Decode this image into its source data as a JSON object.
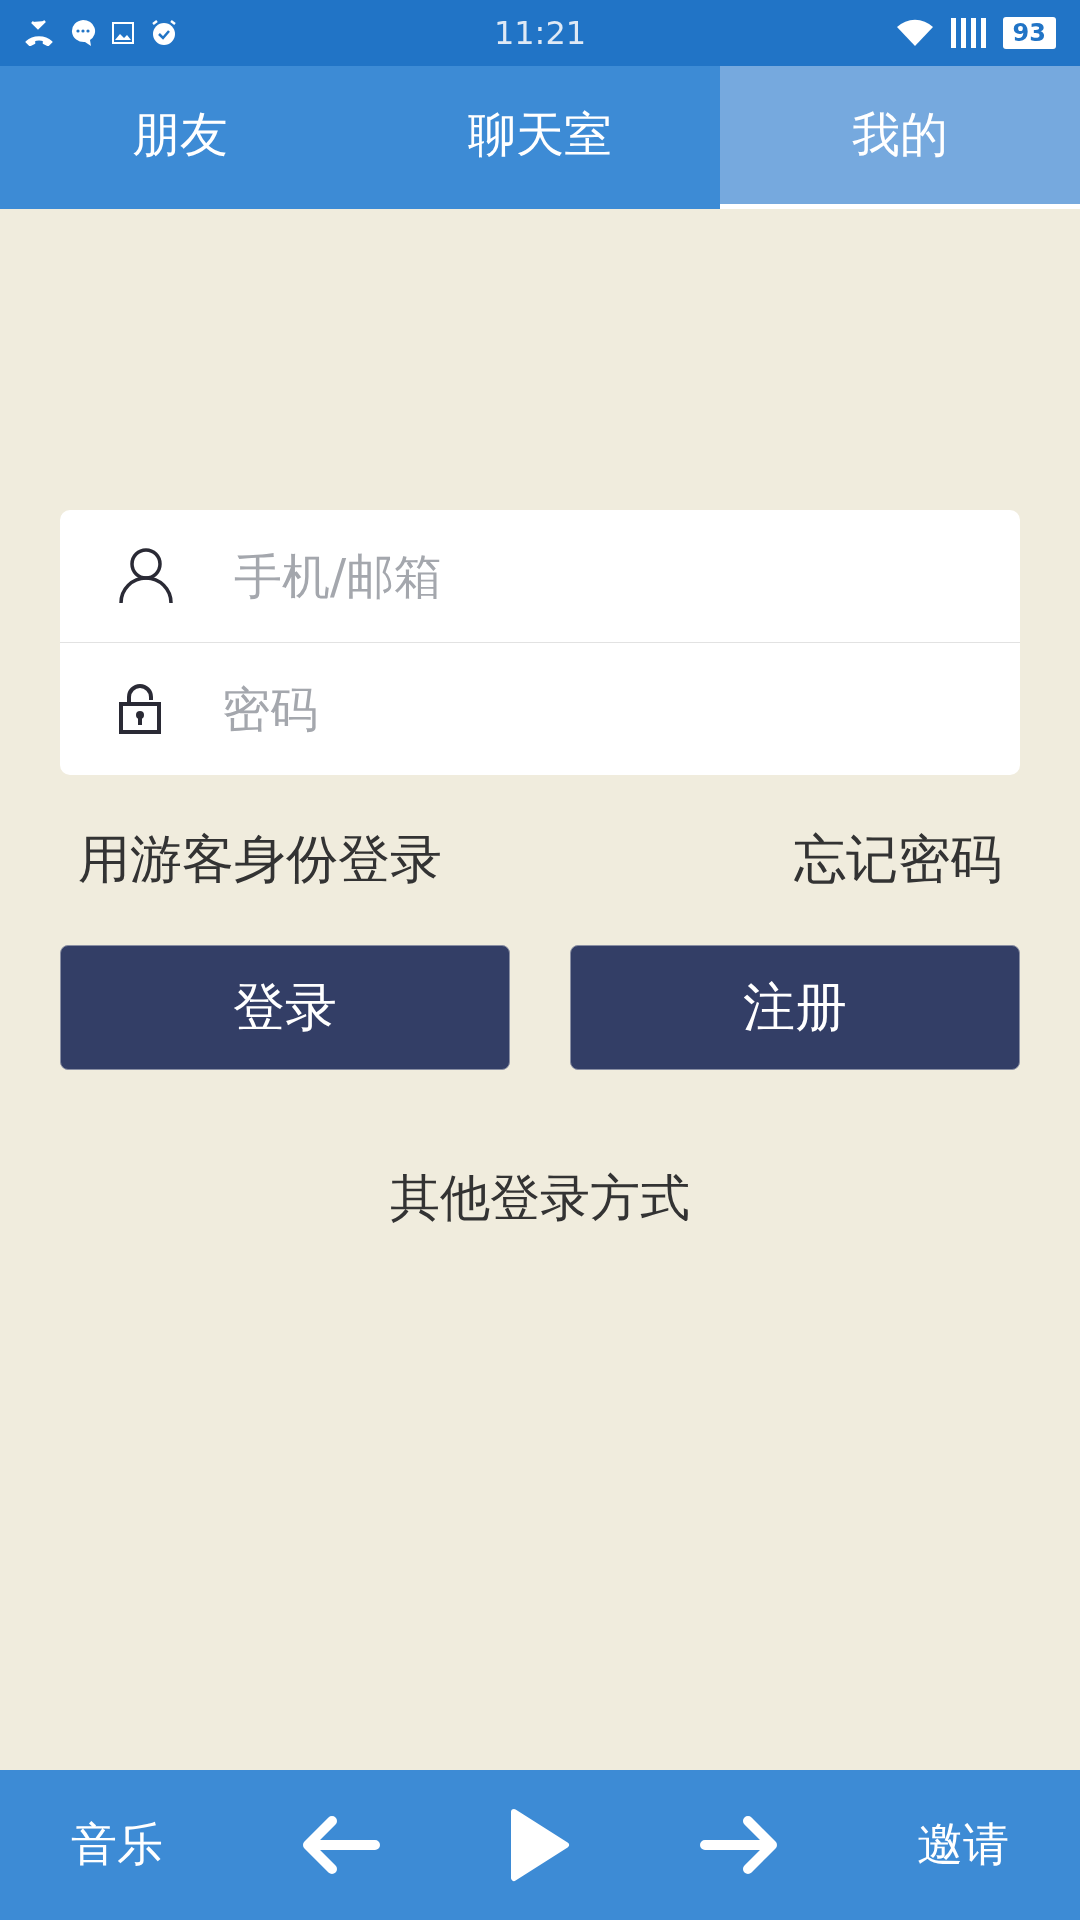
{
  "status_bar": {
    "time": "11:21",
    "battery": "93"
  },
  "tabs": [
    {
      "label": "朋友",
      "selected": false
    },
    {
      "label": "聊天室",
      "selected": false
    },
    {
      "label": "我的",
      "selected": true
    }
  ],
  "login_form": {
    "fields": [
      {
        "kind": "user",
        "placeholder": "手机/邮箱"
      },
      {
        "kind": "password",
        "placeholder": "密码"
      }
    ],
    "guest_link": "用游客身份登录",
    "forgot_link": "忘记密码",
    "buttons": [
      "登录",
      "注册"
    ],
    "other_methods": "其他登录方式"
  },
  "bottom_bar": {
    "left": "音乐",
    "right": "邀请"
  }
}
